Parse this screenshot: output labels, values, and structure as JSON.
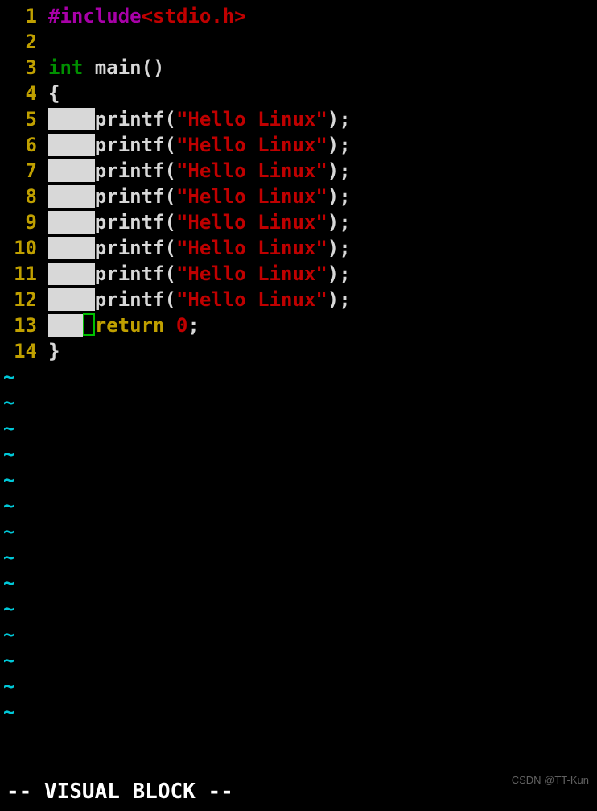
{
  "mode_line": "-- VISUAL BLOCK --",
  "watermark": "CSDN @TT-Kun",
  "tilde": "~",
  "tilde_rows": 14,
  "code": {
    "total_lines": 14,
    "line1": {
      "num": "1",
      "include": "#include",
      "header": "<stdio.h>"
    },
    "line2": {
      "num": "2"
    },
    "line3": {
      "num": "3",
      "type": "int",
      "ident": " main",
      "parens": "()"
    },
    "line4": {
      "num": "4",
      "brace": "{"
    },
    "printf_lines": [
      {
        "num": "5",
        "indent_sel": "    ",
        "fn": "printf",
        "open": "(",
        "str": "\"Hello Linux\"",
        "close": ");"
      },
      {
        "num": "6",
        "indent_sel": "    ",
        "fn": "printf",
        "open": "(",
        "str": "\"Hello Linux\"",
        "close": ");"
      },
      {
        "num": "7",
        "indent_sel": "    ",
        "fn": "printf",
        "open": "(",
        "str": "\"Hello Linux\"",
        "close": ");"
      },
      {
        "num": "8",
        "indent_sel": "    ",
        "fn": "printf",
        "open": "(",
        "str": "\"Hello Linux\"",
        "close": ");"
      },
      {
        "num": "9",
        "indent_sel": "    ",
        "fn": "printf",
        "open": "(",
        "str": "\"Hello Linux\"",
        "close": ");"
      },
      {
        "num": "10",
        "indent_sel": "    ",
        "fn": "printf",
        "open": "(",
        "str": "\"Hello Linux\"",
        "close": ");"
      },
      {
        "num": "11",
        "indent_sel": "    ",
        "fn": "printf",
        "open": "(",
        "str": "\"Hello Linux\"",
        "close": ");"
      },
      {
        "num": "12",
        "indent_sel": "    ",
        "fn": "printf",
        "open": "(",
        "str": "\"Hello Linux\"",
        "close": ");"
      }
    ],
    "line13": {
      "num": "13",
      "indent_sel": "   ",
      "keyword": "return",
      "sp": " ",
      "val": "0",
      "semi": ";"
    },
    "line14": {
      "num": "14",
      "brace": "}"
    }
  }
}
